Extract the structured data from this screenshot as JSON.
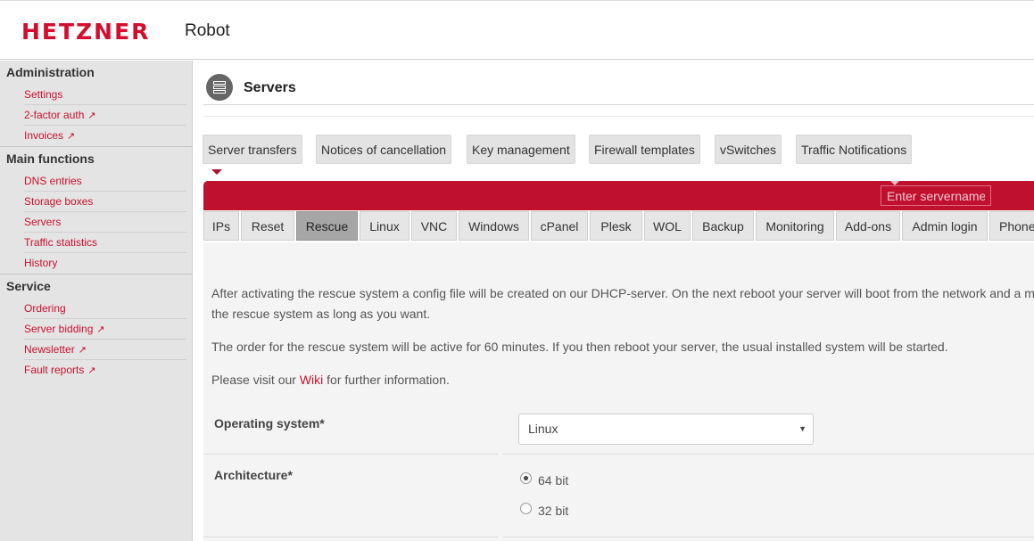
{
  "header": {
    "brand": "HETZNER",
    "product": "Robot"
  },
  "sidebar": {
    "sections": [
      {
        "title": "Administration",
        "items": [
          {
            "label": "Settings",
            "external": false
          },
          {
            "label": "2-factor auth",
            "external": true
          },
          {
            "label": "Invoices",
            "external": true
          }
        ]
      },
      {
        "title": "Main functions",
        "items": [
          {
            "label": "DNS entries",
            "external": false
          },
          {
            "label": "Storage boxes",
            "external": false
          },
          {
            "label": "Servers",
            "external": false
          },
          {
            "label": "Traffic statistics",
            "external": false
          },
          {
            "label": "History",
            "external": false
          }
        ]
      },
      {
        "title": "Service",
        "items": [
          {
            "label": "Ordering",
            "external": false
          },
          {
            "label": "Server bidding",
            "external": true
          },
          {
            "label": "Newsletter",
            "external": true
          },
          {
            "label": "Fault reports",
            "external": true
          }
        ]
      }
    ],
    "external_icon": "external-link-icon"
  },
  "page": {
    "title": "Servers",
    "icon": "server-list-icon"
  },
  "subtabs": [
    "Server transfers",
    "Notices of cancellation",
    "Key management",
    "Firewall templates",
    "vSwitches",
    "Traffic Notifications"
  ],
  "server_search": {
    "placeholder": "Enter servername"
  },
  "tabs": {
    "items": [
      "IPs",
      "Reset",
      "Rescue",
      "Linux",
      "VNC",
      "Windows",
      "cPanel",
      "Plesk",
      "WOL",
      "Backup",
      "Monitoring",
      "Add-ons",
      "Admin login",
      "Phone"
    ],
    "active": "Rescue"
  },
  "content": {
    "para1_line1": "After activating the rescue system a config file will be created on our DHCP-server. On the next reboot your server will boot from the network and a m",
    "para1_line2": "the rescue system as long as you want.",
    "para2": "The order for the rescue system will be active for 60 minutes. If you then reboot your server, the usual installed system will be started.",
    "para3_before": "Please visit our ",
    "para3_link": "Wiki",
    "para3_after": " for further information."
  },
  "form": {
    "os_label": "Operating system*",
    "os_value": "Linux",
    "arch_label": "Architecture*",
    "arch_options": [
      {
        "label": "64 bit",
        "selected": true
      },
      {
        "label": "32 bit",
        "selected": false
      }
    ]
  },
  "colors": {
    "brand_red": "#d50c2d",
    "bar_red": "#c0102f",
    "link_red": "#c8102e",
    "sidebar_bg": "#e4e4e4"
  }
}
